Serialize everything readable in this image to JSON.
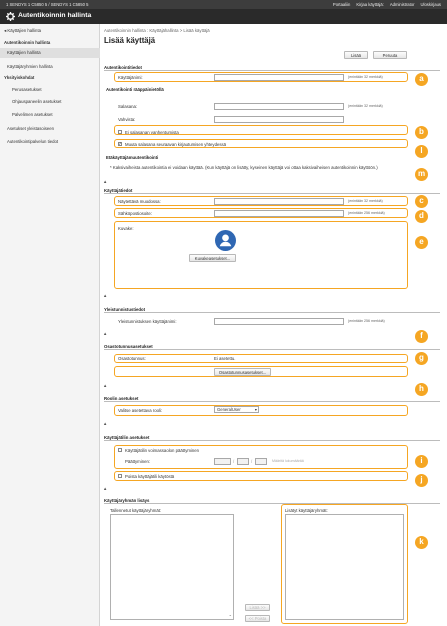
{
  "topbar": {
    "device": "1 SENDYS 1 C5850 5 / SENDYS 1 C5850 5",
    "links": [
      "Portaaliin",
      "Kirjaa käyttäjä:",
      "Administrator",
      "Uloskirjaus"
    ]
  },
  "app": {
    "title": "Autentikoinnin hallinta",
    "icon": "gear-icon"
  },
  "sidebar": {
    "back": "◂ Käyttäjien hallinta",
    "items": [
      {
        "label": "Autentikoinnin hallinta",
        "bold": true
      },
      {
        "label": "Käyttäjien hallinta",
        "selected": true
      },
      {
        "label": "Käyttäjäryhmien hallinta"
      },
      {
        "label": "Yksityiskohdat",
        "bold": true
      },
      {
        "label": "Perusasetukset",
        "indent": true
      },
      {
        "label": "Ohjauspaneelin asetukset",
        "indent": true
      },
      {
        "label": "Palvelimen asetukset",
        "indent": true
      },
      {
        "label": "Asetukset yleistasoiseen"
      },
      {
        "label": "Autentikointipalvelun tiedot"
      }
    ]
  },
  "main": {
    "breadcrumb": "Autentikoinnin hallinta : Käyttäjähallinta > Lisää käyttäjä",
    "title": "Lisää käyttäjä",
    "add_button": "Lisää",
    "cancel_button": "Peruuta"
  },
  "auth": {
    "section": "Autentikointitiedot",
    "username_label": "Käyttäjänimi:",
    "username_hint": "(enintään 32 merkkiä)",
    "password_section": "Autentikointi rääppäinietöllä",
    "password_label": "Salasana:",
    "password_hint": "(enintään 32 merkkiä)",
    "confirm_label": "Vahvista:",
    "opt1": "Ei salasanan vanhentumista",
    "opt2": "Muuta salasana seuraavan kirjautumisen yhteydessä",
    "biometric_heading": "Etäkäyttäjämuutentikointi",
    "biometric_note": "* Kaksivaiheista autentikointia ei voidaan käyttää. (Kun käyttäjä on lisätty, kyseinen käyttäjä voi ottaa kaksivaiheisen autentikoinnin käyttöön.)"
  },
  "user": {
    "section": "Käyttäjätiedot",
    "display_label": "Näytettävä muodossa:",
    "display_hint": "(enintään 32 merkkiä)",
    "email_label": "Sähköpostiosoite:",
    "email_hint": "(enintään 256 merkkiä)",
    "image_label": "Kuvake:",
    "image_button": "Kuvakeasetukset...",
    "avatar_icon": "user-avatar-icon"
  },
  "general": {
    "section": "Yleistunnistustiedot",
    "label": "Yleistunnistuksen käyttäjänimi:",
    "hint": "(enintään 256 merkkiä)"
  },
  "dept": {
    "section": "Osastotunnusasetukset",
    "label": "Osastotunnus:",
    "value": "Ei asetettu.",
    "button": "Osastotunnusasetukset..."
  },
  "role": {
    "section": "Roolin asetukset",
    "label": "Valitse asetettava rooli:",
    "value": "GeneralUser"
  },
  "account": {
    "section": "Käyttäjätilin asetukset",
    "expiry_label": "Käyttäjätilin voimassaolon päättyminen",
    "date_label": "Päättyminen:",
    "date_hint": "Määritä lukumäärää",
    "disable_label": "Poista käyttäjätili käytöstä"
  },
  "groups": {
    "section": "Käyttäjäryhmän lisäys",
    "registered_label": "Tallennetut käyttäjäryhmät:",
    "added_label": "Lisätyt käyttäjäryhmät:",
    "add_button": "Lisää >>",
    "remove_button": "<< Poista"
  },
  "callouts": [
    "a",
    "b",
    "l",
    "m",
    "c",
    "d",
    "e",
    "f",
    "g",
    "h",
    "i",
    "j",
    "k"
  ],
  "colors": {
    "accent": "#f5a623",
    "header": "#2a2a2a"
  }
}
